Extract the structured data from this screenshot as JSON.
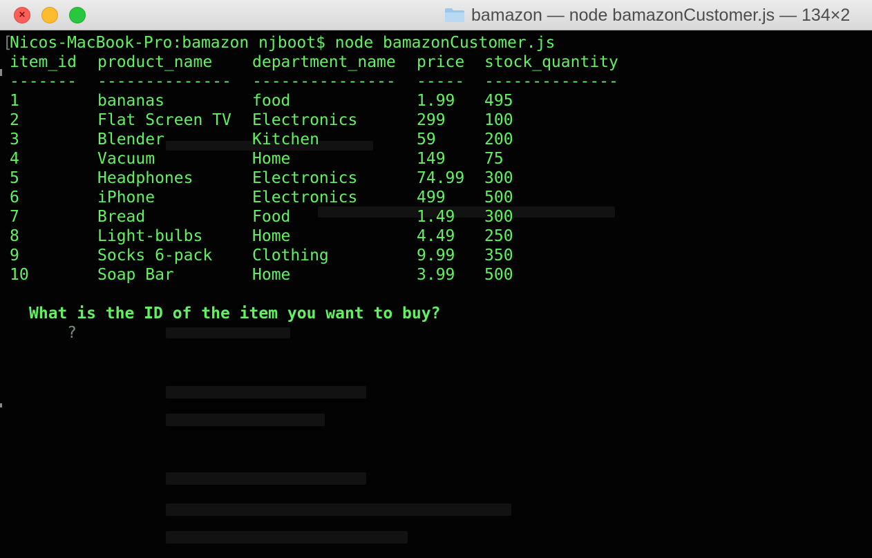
{
  "window": {
    "title": "bamazon — node bamazonCustomer.js — 134×2",
    "folder_icon": "folder-icon",
    "buttons": {
      "close": "close-button",
      "minimize": "minimize-button",
      "zoom": "zoom-button",
      "close_glyph": "×"
    }
  },
  "terminal": {
    "prompt_line": "Nicos-MacBook-Pro:bamazon njboot$ node bamazonCustomer.js",
    "table": {
      "headers": [
        "item_id",
        "product_name",
        "department_name",
        "price",
        "stock_quantity"
      ],
      "separators": [
        "-------",
        "--------------",
        "---------------",
        "-----",
        "--------------"
      ],
      "rows": [
        [
          "1",
          "bananas",
          "food",
          "1.99",
          "495"
        ],
        [
          "2",
          "Flat Screen TV",
          "Electronics",
          "299",
          "100"
        ],
        [
          "3",
          "Blender",
          "Kitchen",
          "59",
          "200"
        ],
        [
          "4",
          "Vacuum",
          "Home",
          "149",
          "75"
        ],
        [
          "5",
          "Headphones",
          "Electronics",
          "74.99",
          "300"
        ],
        [
          "6",
          "iPhone",
          "Electronics",
          "499",
          "500"
        ],
        [
          "7",
          "Bread",
          "Food",
          "1.49",
          "300"
        ],
        [
          "8",
          "Light-bulbs",
          "Home",
          "4.49",
          "250"
        ],
        [
          "9",
          "Socks 6-pack",
          "Clothing",
          "9.99",
          "350"
        ],
        [
          "10",
          "Soap Bar",
          "Home",
          "3.99",
          "500"
        ]
      ]
    },
    "question_mark": "?",
    "question": "What is the ID of the item you want to buy?",
    "colors": {
      "text": "#63f063",
      "background": "#030303"
    }
  }
}
